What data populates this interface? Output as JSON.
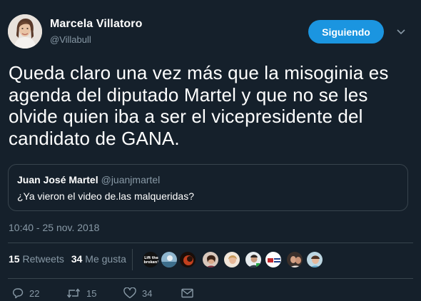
{
  "user": {
    "display_name": "Marcela Villatoro",
    "handle": "@Villabull"
  },
  "follow_button": {
    "label": "Siguiendo",
    "color": "#1b95e0"
  },
  "tweet": {
    "lines": [
      "Queda claro una vez más que la misoginia es",
      "agenda del diputado Martel y que no se les",
      "olvide quien iba a ser el vicepresidente del",
      "candidato de GANA."
    ]
  },
  "quoted_tweet": {
    "display_name": "Juan José Martel",
    "handle": "@juanjmartel",
    "text": "¿Ya vieron el video de.las malqueridas?"
  },
  "timestamp": "10:40 - 25 nov. 2018",
  "stats": {
    "retweets_count": "15",
    "retweets_label": "Retweets",
    "likes_count": "34",
    "likes_label": "Me gusta"
  },
  "likers": {
    "badge_text": [
      "Lift the",
      "broken!"
    ]
  },
  "actions": {
    "replies": "22",
    "retweets": "15",
    "likes": "34"
  },
  "colors": {
    "background": "#15202b",
    "secondary_text": "#8899a6",
    "border": "#38444d"
  }
}
